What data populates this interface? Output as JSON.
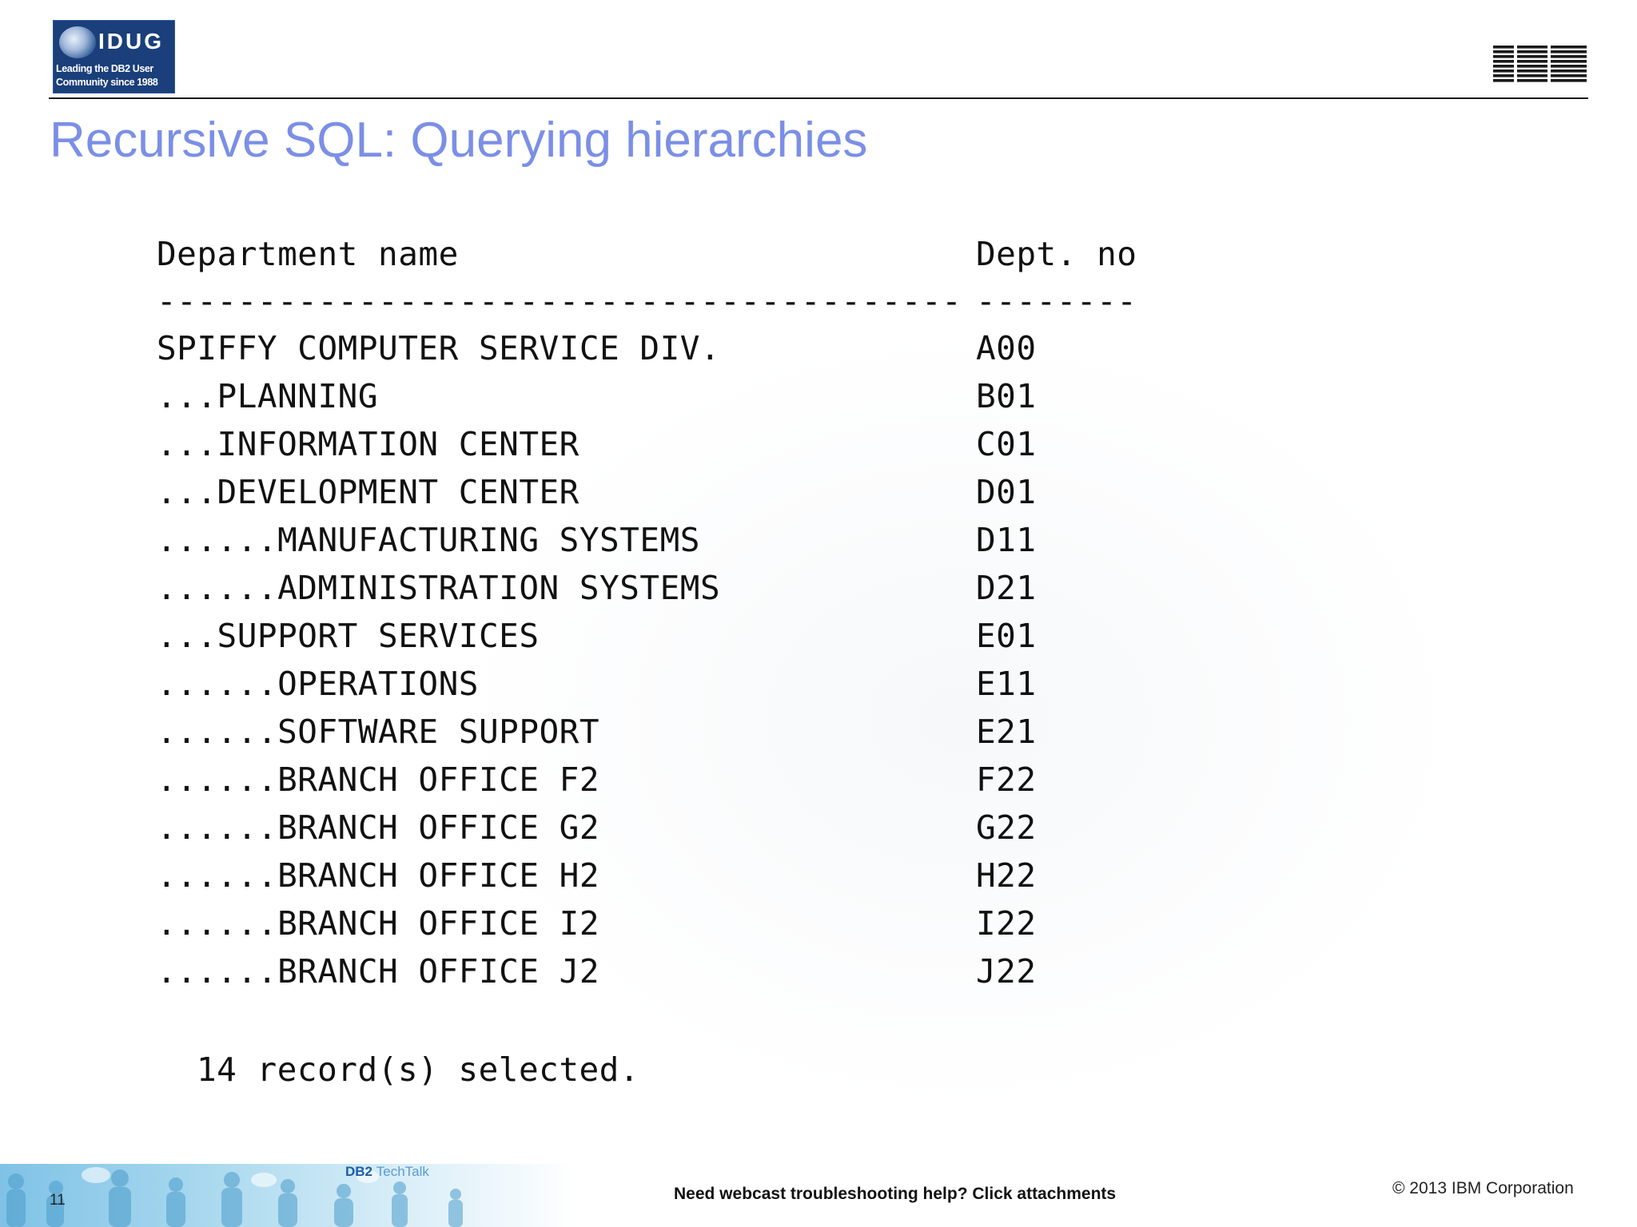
{
  "header": {
    "idug_logo": {
      "wordmark": "IDUG",
      "tagline_line1": "Leading the DB2 User",
      "tagline_line2": "Community since 1988"
    },
    "ibm_logo_text": "IBM",
    "title": "Recursive SQL: Querying hierarchies"
  },
  "listing": {
    "header_name": "Department name",
    "header_no": "Dept. no",
    "separator_name": "----------------------------------------",
    "separator_no": "--------",
    "rows": [
      {
        "name": "SPIFFY COMPUTER SERVICE DIV.",
        "no": "A00"
      },
      {
        "name": "...PLANNING",
        "no": "B01"
      },
      {
        "name": "...INFORMATION CENTER",
        "no": "C01"
      },
      {
        "name": "...DEVELOPMENT CENTER",
        "no": "D01"
      },
      {
        "name": "......MANUFACTURING SYSTEMS",
        "no": "D11"
      },
      {
        "name": "......ADMINISTRATION SYSTEMS",
        "no": "D21"
      },
      {
        "name": "...SUPPORT SERVICES",
        "no": "E01"
      },
      {
        "name": "......OPERATIONS",
        "no": "E11"
      },
      {
        "name": "......SOFTWARE SUPPORT",
        "no": "E21"
      },
      {
        "name": "......BRANCH OFFICE F2",
        "no": "F22"
      },
      {
        "name": "......BRANCH OFFICE G2",
        "no": "G22"
      },
      {
        "name": "......BRANCH OFFICE H2",
        "no": "H22"
      },
      {
        "name": "......BRANCH OFFICE I2",
        "no": "I22"
      },
      {
        "name": "......BRANCH OFFICE J2",
        "no": "J22"
      }
    ],
    "summary": "14 record(s) selected."
  },
  "footer": {
    "slide_number": "11",
    "techtalk_db2": "DB2",
    "techtalk_label": "TechTalk",
    "help_text": "Need webcast troubleshooting help? Click attachments",
    "copyright": "© 2013 IBM Corporation"
  },
  "colors": {
    "title": "#7b8fe6",
    "idug_blue": "#1a3f7a",
    "footer_band": "#7fc2e6"
  }
}
